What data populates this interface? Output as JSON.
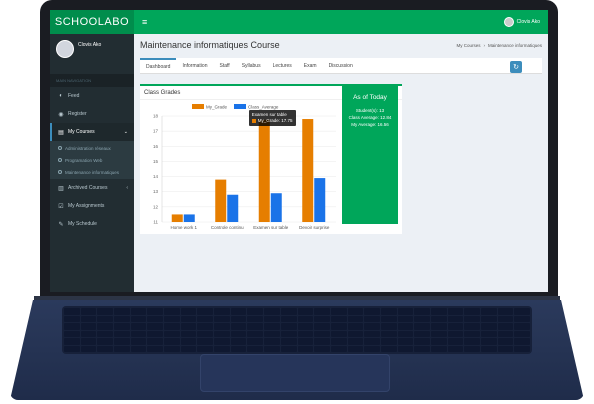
{
  "app": {
    "logo": "SCHOOLABO",
    "menu_icon": "hamburger-icon"
  },
  "user": {
    "name": "Clovis Ako"
  },
  "sidebar": {
    "header": "MAIN NAVIGATION",
    "items": [
      {
        "label": "Feed",
        "icon": "dashboard-icon"
      },
      {
        "label": "Register",
        "icon": "circle-dot-icon"
      },
      {
        "label": "My Courses",
        "icon": "book-icon",
        "active": true
      },
      {
        "label": "Archived Courses",
        "icon": "archive-icon"
      },
      {
        "label": "My Assignments",
        "icon": "check-square-icon"
      },
      {
        "label": "My Schedule",
        "icon": "edit-icon"
      }
    ],
    "sub_items": [
      {
        "label": "Administration réseaux"
      },
      {
        "label": "Programation Web"
      },
      {
        "label": "Maintenance informatiques"
      }
    ]
  },
  "page": {
    "title": "Maintenance informatiques Course",
    "breadcrumb": [
      "My Courses",
      "Maintenance informatiques"
    ]
  },
  "tabs": [
    "Dashboard",
    "Information",
    "Staff",
    "Syllabus",
    "Lectures",
    "Exam",
    "Discussion"
  ],
  "box": {
    "title": "Class Grades",
    "minimize": "−",
    "close": "×"
  },
  "stats": {
    "title": "As of Today",
    "students": "Student(s): 13",
    "class_average": "Class Average: 12.84",
    "my_average": "My Average: 16.56"
  },
  "tooltip": {
    "title": "Examen sur table",
    "line": "My_Grade: 17.75"
  },
  "chart_data": {
    "type": "bar",
    "categories": [
      "Home work 1",
      "Controle continu",
      "Examen sur table",
      "Devoir surprise"
    ],
    "series": [
      {
        "name": "My_Grade",
        "color": "#e67e00",
        "values": [
          11.5,
          13.8,
          17.75,
          17.8
        ]
      },
      {
        "name": "Class_Average",
        "color": "#1a73e8",
        "values": [
          11.5,
          12.8,
          12.9,
          13.9
        ]
      }
    ],
    "ylim": [
      11,
      18
    ],
    "yticks": [
      11,
      12,
      13,
      14,
      15,
      16,
      17,
      18
    ],
    "legend": "top"
  }
}
